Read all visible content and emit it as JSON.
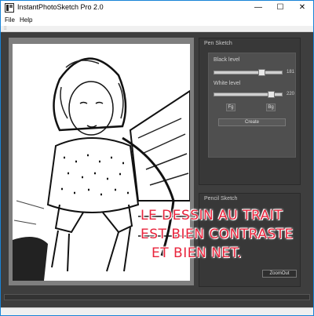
{
  "window": {
    "title": "InstantPhotoSketch Pro 2.0",
    "minimize_glyph": "—",
    "maximize_glyph": "☐",
    "close_glyph": "✕"
  },
  "menu": {
    "items": [
      {
        "label": "File"
      },
      {
        "label": "Help"
      }
    ]
  },
  "toolstrip": {
    "grip": "⁞⁞"
  },
  "pen_sketch": {
    "title": "Pen Sketch",
    "black_level": {
      "label": "Black level",
      "value": "181",
      "level": 0.71
    },
    "white_level": {
      "label": "White level",
      "value": "220",
      "level": 0.86
    },
    "fg_label": "Fg",
    "bg_label": "Bg",
    "create_label": "Create"
  },
  "pencil_sketch": {
    "title": "Pencil Sketch"
  },
  "zoom": {
    "zoom_out_label": "ZoomOut"
  },
  "overlay": {
    "lines": [
      "LE DESSIN AU TRAIT",
      "EST BIEN CONTRASTE",
      "ET BIEN NET."
    ]
  },
  "colors": {
    "overlay_text": "#e8243c",
    "workspace": "#3e3e3e",
    "panel": "#383838",
    "title_accent": "#1883d7"
  },
  "icons": {
    "app": "sketch-app-icon"
  }
}
